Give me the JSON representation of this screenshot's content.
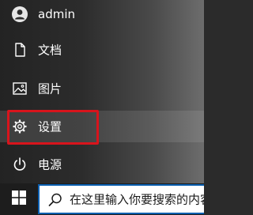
{
  "menu": {
    "items": [
      {
        "name": "user",
        "label": "admin",
        "icon": "user-avatar-icon"
      },
      {
        "name": "documents",
        "label": "文档",
        "icon": "document-icon"
      },
      {
        "name": "pictures",
        "label": "图片",
        "icon": "picture-icon"
      },
      {
        "name": "settings",
        "label": "设置",
        "icon": "gear-icon"
      },
      {
        "name": "power",
        "label": "电源",
        "icon": "power-icon"
      }
    ],
    "hovered_item": "settings",
    "highlight_color": "#d8141c"
  },
  "taskbar": {
    "search": {
      "placeholder": "在这里输入你要搜索的内容",
      "icon": "search-icon",
      "border_color": "#0a5fb0"
    },
    "start_icon": "windows-logo-icon"
  }
}
